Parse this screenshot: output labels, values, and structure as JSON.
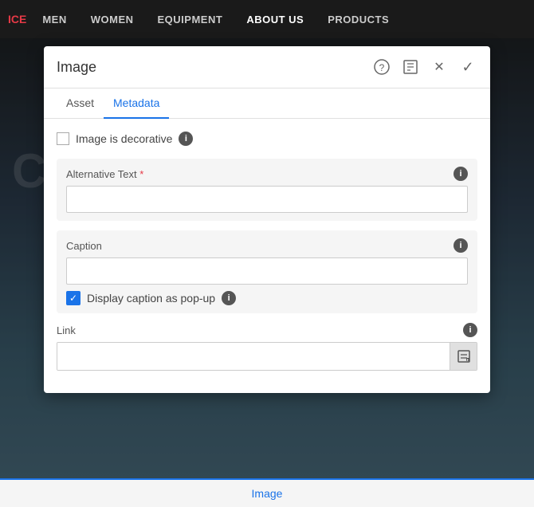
{
  "navbar": {
    "brand": "ICE",
    "items": [
      {
        "label": "MEN",
        "active": false
      },
      {
        "label": "WOMEN",
        "active": false
      },
      {
        "label": "EQUIPMENT",
        "active": false
      },
      {
        "label": "ABOUT US",
        "active": true
      },
      {
        "label": "PRODUCTS",
        "active": false
      }
    ]
  },
  "hero_text": "CT",
  "modal": {
    "title": "Image",
    "tabs": [
      {
        "label": "Asset",
        "active": false
      },
      {
        "label": "Metadata",
        "active": true
      }
    ],
    "decorative_label": "Image is decorative",
    "alt_text": {
      "label": "Alternative Text",
      "required": true,
      "value": "",
      "placeholder": ""
    },
    "caption": {
      "label": "Caption",
      "value": "",
      "placeholder": "",
      "popup_label": "Display caption as pop-up",
      "popup_checked": true
    },
    "link": {
      "label": "Link",
      "value": "",
      "placeholder": ""
    },
    "icons": {
      "help": "?",
      "expand": "⤢",
      "close": "✕",
      "check": "✓"
    }
  },
  "bottom_bar": {
    "label": "Image"
  }
}
